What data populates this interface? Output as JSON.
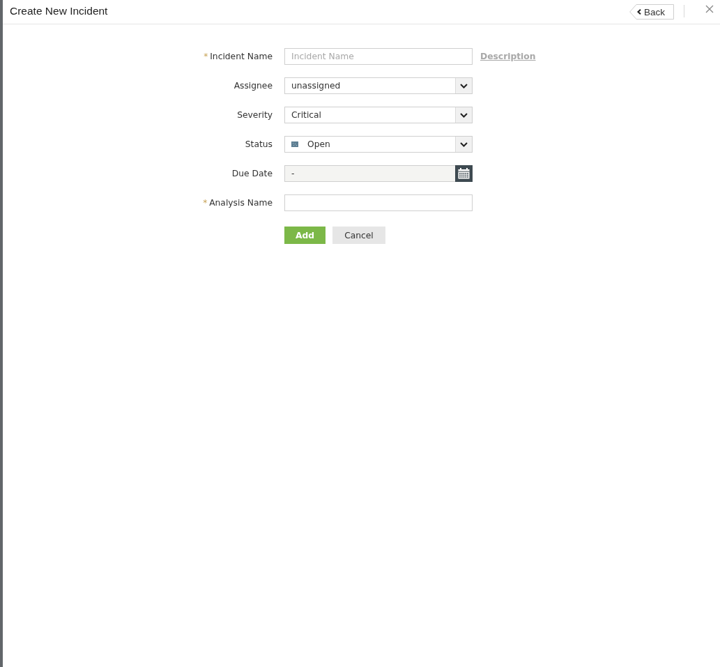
{
  "window": {
    "title": "Create New Incident",
    "back_button": "Back"
  },
  "form": {
    "fields": [
      {
        "kind": "text",
        "required_mark": "*",
        "label": "Incident Name",
        "placeholder": "Incident Name",
        "link": "Description"
      },
      {
        "kind": "select",
        "label": "Assignee",
        "value": "unassigned"
      },
      {
        "kind": "select",
        "label": "Severity",
        "value": "Critical"
      },
      {
        "kind": "status_select",
        "label": "Status",
        "value": "Open"
      },
      {
        "kind": "date",
        "label": "Due Date",
        "value": "-"
      },
      {
        "kind": "text",
        "required_mark": "*",
        "label": "Analysis Name"
      }
    ]
  },
  "buttons": [
    {
      "kind": "primary",
      "label": "Add"
    },
    {
      "kind": "secondary",
      "label": "Cancel"
    }
  ]
}
